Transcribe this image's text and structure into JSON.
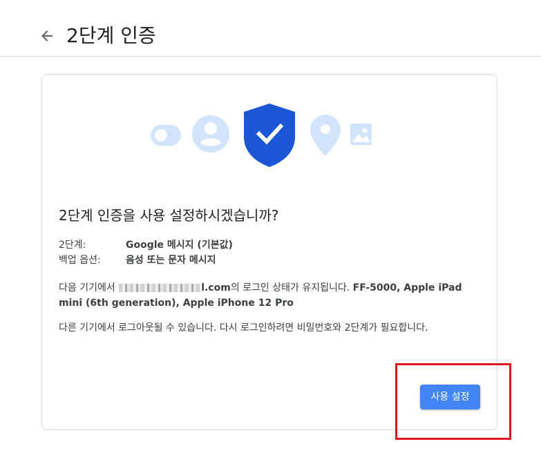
{
  "header": {
    "title": "2단계 인증",
    "back_icon": "arrow-left-icon"
  },
  "illustration": {
    "icons": [
      "toggle-icon",
      "account-icon",
      "shield-check-icon",
      "location-pin-icon",
      "image-icon"
    ],
    "colors": {
      "light": "#d2e3fc",
      "accent": "#1a56d6"
    }
  },
  "card": {
    "title": "2단계 인증을 사용 설정하시겠습니까?",
    "info": [
      {
        "label": "2단계:",
        "value": "Google 메시지 (기본값)"
      },
      {
        "label": "백업 옵션:",
        "value": "음성 또는 문자 메시지"
      }
    ],
    "devices_text_before": "다음 기기에서",
    "email_suffix": "l.com",
    "devices_text_after": "의 로그인 상태가 유지됩니다.",
    "devices_list_line1": "FF-5000, Apple iPad",
    "devices_list_line2": "mini (6th generation), Apple iPhone 12 Pro",
    "logout_note": "다른 기기에서 로그아웃될 수 있습니다. 다시 로그인하려면 비밀번호와 2단계가 필요합니다.",
    "enable_button": "사용 설정"
  },
  "colors": {
    "button": "#4285f4",
    "highlight": "#e0141e",
    "border": "#dadce0"
  }
}
